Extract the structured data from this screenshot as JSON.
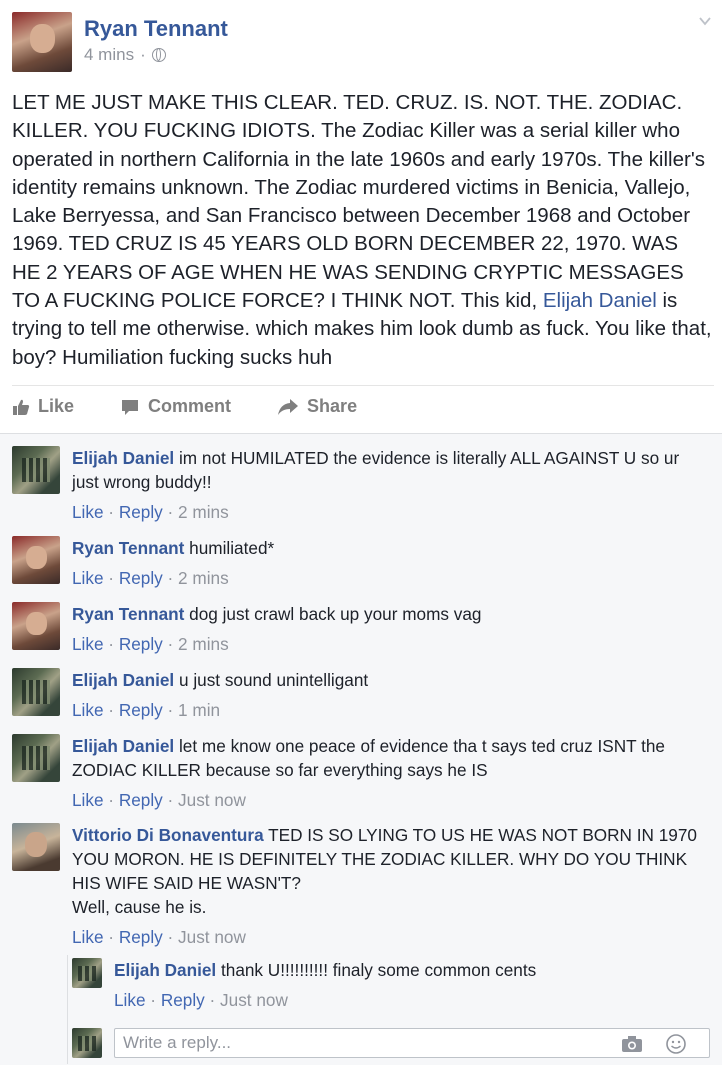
{
  "post": {
    "author": "Ryan Tennant",
    "time": "4 mins",
    "dot": "·",
    "text_before_mention": "LET ME JUST MAKE THIS CLEAR. TED. CRUZ. IS. NOT. THE. ZODIAC. KILLER. YOU FUCKING IDIOTS. The Zodiac Killer was a serial killer who operated in northern California in the late 1960s and early 1970s. The killer's identity remains unknown. The Zodiac murdered victims in Benicia, Vallejo, Lake Berryessa, and San Francisco between December 1968 and October 1969. TED CRUZ IS 45 YEARS OLD BORN DECEMBER 22, 1970. WAS HE 2 YEARS OF AGE WHEN HE WAS SENDING CRYPTIC MESSAGES TO A FUCKING POLICE FORCE? I THINK NOT. This kid, ",
    "mention": "Elijah Daniel",
    "text_after_mention": " is trying to tell me otherwise. which makes him look dumb as fuck. You like that, boy? Humiliation fucking sucks huh",
    "actions": {
      "like": "Like",
      "comment": "Comment",
      "share": "Share"
    }
  },
  "comments": [
    {
      "author": "Elijah Daniel",
      "text": "im not HUMILATED the evidence is literally ALL AGAINST U so ur just wrong buddy!!",
      "like": "Like",
      "reply": "Reply",
      "time": "2 mins"
    },
    {
      "author": "Ryan Tennant",
      "text": "humiliated*",
      "like": "Like",
      "reply": "Reply",
      "time": "2 mins"
    },
    {
      "author": "Ryan Tennant",
      "text": "dog just crawl back up your moms vag",
      "like": "Like",
      "reply": "Reply",
      "time": "2 mins"
    },
    {
      "author": "Elijah Daniel",
      "text": "u just sound unintelligant",
      "like": "Like",
      "reply": "Reply",
      "time": "1 min"
    },
    {
      "author": "Elijah Daniel",
      "text": "let me know one peace of evidence tha t says ted cruz ISNT the ZODIAC KILLER because so far everything says he IS",
      "like": "Like",
      "reply": "Reply",
      "time": "Just now"
    },
    {
      "author": "Vittorio Di Bonaventura",
      "text": "TED IS SO LYING TO US HE WAS NOT BORN IN 1970 YOU MORON. HE IS DEFINITELY THE ZODIAC KILLER. WHY DO YOU THINK HIS WIFE SAID HE WASN'T?",
      "text2": "Well, cause he is.",
      "like": "Like",
      "reply": "Reply",
      "time": "Just now"
    }
  ],
  "reply": {
    "author": "Elijah Daniel",
    "text": "thank U!!!!!!!!!! finaly some common cents",
    "like": "Like",
    "reply": "Reply",
    "time": "Just now"
  },
  "reply_box": {
    "placeholder": "Write a reply..."
  },
  "sep": " · ",
  "colors": {
    "link": "#365899",
    "action_link": "#4267b2",
    "muted": "#90949c",
    "comment_bg": "#f6f7f9"
  }
}
